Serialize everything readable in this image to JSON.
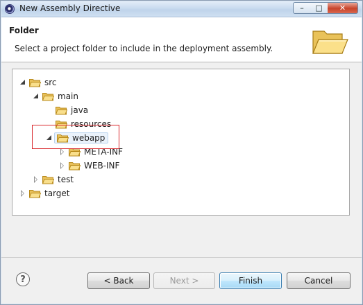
{
  "window": {
    "title": "New Assembly Directive",
    "minimize_icon": "minimize-icon",
    "maximize_icon": "maximize-icon",
    "close_icon": "close-icon"
  },
  "header": {
    "title": "Folder",
    "description": "Select a project folder to include in the deployment assembly.",
    "icon": "open-folder-icon"
  },
  "tree": {
    "nodes": [
      {
        "label": "src",
        "expanded": true,
        "depth": 0
      },
      {
        "label": "main",
        "expanded": true,
        "depth": 1
      },
      {
        "label": "java",
        "expanded": null,
        "depth": 2
      },
      {
        "label": "resources",
        "expanded": null,
        "depth": 2
      },
      {
        "label": "webapp",
        "expanded": true,
        "depth": 2,
        "selected": true
      },
      {
        "label": "META-INF",
        "expanded": false,
        "depth": 3
      },
      {
        "label": "WEB-INF",
        "expanded": false,
        "depth": 3
      },
      {
        "label": "test",
        "expanded": false,
        "depth": 1
      },
      {
        "label": "target",
        "expanded": false,
        "depth": 0
      }
    ]
  },
  "footer": {
    "help_icon": "help-icon",
    "help_glyph": "?",
    "back_label": "< Back",
    "next_label": "Next >",
    "finish_label": "Finish",
    "cancel_label": "Cancel"
  },
  "colors": {
    "highlight_box": "#d9262b",
    "folder_fill": "#f7d56b",
    "folder_stroke": "#b88a1c"
  }
}
